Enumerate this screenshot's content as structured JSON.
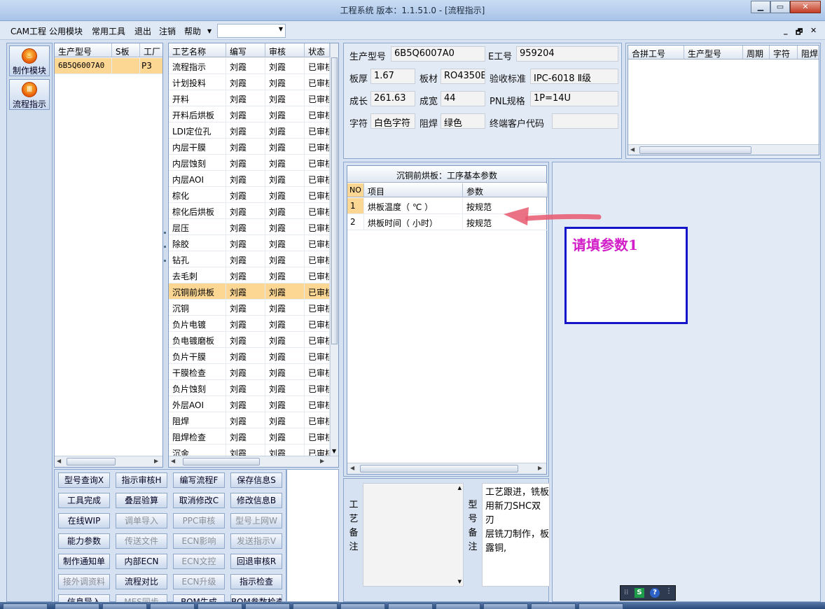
{
  "window": {
    "title": "工程系统   版本：1.1.51.0 - [流程指示]"
  },
  "menu": [
    "CAM工程",
    "公用模块",
    "常用工具",
    "退出",
    "注销",
    "帮助"
  ],
  "nav": [
    {
      "label": "制作模块",
      "icon": "flame-icon"
    },
    {
      "label": "流程指示",
      "icon": "flow-icon"
    }
  ],
  "model_grid": {
    "headers": [
      "生产型号",
      "S板",
      "工厂"
    ],
    "rows": [
      [
        "6B5Q6007A0",
        "",
        "P3"
      ]
    ]
  },
  "process_grid": {
    "headers": [
      "工艺名称",
      "编写",
      "审核",
      "状态"
    ],
    "selected_index": 14,
    "rows": [
      [
        "流程指示",
        "刘霞",
        "刘霞",
        "已审核"
      ],
      [
        "计划投料",
        "刘霞",
        "刘霞",
        "已审核"
      ],
      [
        "开料",
        "刘霞",
        "刘霞",
        "已审核"
      ],
      [
        "开料后烘板",
        "刘霞",
        "刘霞",
        "已审核"
      ],
      [
        "LDI定位孔",
        "刘霞",
        "刘霞",
        "已审核"
      ],
      [
        "内层干膜",
        "刘霞",
        "刘霞",
        "已审核"
      ],
      [
        "内层蚀刻",
        "刘霞",
        "刘霞",
        "已审核"
      ],
      [
        "内层AOI",
        "刘霞",
        "刘霞",
        "已审核"
      ],
      [
        "棕化",
        "刘霞",
        "刘霞",
        "已审核"
      ],
      [
        "棕化后烘板",
        "刘霞",
        "刘霞",
        "已审核"
      ],
      [
        "层压",
        "刘霞",
        "刘霞",
        "已审核"
      ],
      [
        "除胶",
        "刘霞",
        "刘霞",
        "已审核"
      ],
      [
        "钻孔",
        "刘霞",
        "刘霞",
        "已审核"
      ],
      [
        "去毛刺",
        "刘霞",
        "刘霞",
        "已审核"
      ],
      [
        "沉铜前烘板",
        "刘霞",
        "刘霞",
        "已审核"
      ],
      [
        "沉铜",
        "刘霞",
        "刘霞",
        "已审核"
      ],
      [
        "负片电镀",
        "刘霞",
        "刘霞",
        "已审核"
      ],
      [
        "负电镀磨板",
        "刘霞",
        "刘霞",
        "已审核"
      ],
      [
        "负片干膜",
        "刘霞",
        "刘霞",
        "已审核"
      ],
      [
        "干膜检查",
        "刘霞",
        "刘霞",
        "已审核"
      ],
      [
        "负片蚀刻",
        "刘霞",
        "刘霞",
        "已审核"
      ],
      [
        "外层AOI",
        "刘霞",
        "刘霞",
        "已审核"
      ],
      [
        "阻焊",
        "刘霞",
        "刘霞",
        "已审核"
      ],
      [
        "阻焊检查",
        "刘霞",
        "刘霞",
        "已审核"
      ],
      [
        "沉金",
        "刘霞",
        "刘霞",
        "已审核"
      ]
    ]
  },
  "buttons": [
    {
      "label": "型号查询X",
      "enabled": true
    },
    {
      "label": "指示审核H",
      "enabled": true
    },
    {
      "label": "编写流程F",
      "enabled": true
    },
    {
      "label": "保存信息S",
      "enabled": true
    },
    {
      "label": "工具完成",
      "enabled": true
    },
    {
      "label": "叠层验算",
      "enabled": true
    },
    {
      "label": "取消修改C",
      "enabled": true
    },
    {
      "label": "修改信息B",
      "enabled": true
    },
    {
      "label": "在线WIP",
      "enabled": true
    },
    {
      "label": "调单导入",
      "enabled": false
    },
    {
      "label": "PPC审核",
      "enabled": false
    },
    {
      "label": "型号上网W",
      "enabled": false
    },
    {
      "label": "能力参数",
      "enabled": true
    },
    {
      "label": "传送文件",
      "enabled": false
    },
    {
      "label": "ECN影响",
      "enabled": false
    },
    {
      "label": "发送指示V",
      "enabled": false
    },
    {
      "label": "制作通知单",
      "enabled": true
    },
    {
      "label": "内部ECN",
      "enabled": true
    },
    {
      "label": "ECN文控",
      "enabled": false
    },
    {
      "label": "回退审核R",
      "enabled": true
    },
    {
      "label": "接外调资料",
      "enabled": false
    },
    {
      "label": "流程对比",
      "enabled": true
    },
    {
      "label": "ECN升级",
      "enabled": false
    },
    {
      "label": "指示检查",
      "enabled": true
    },
    {
      "label": "信息导入",
      "enabled": true
    },
    {
      "label": "MES同步",
      "enabled": false
    },
    {
      "label": "BOM生成",
      "enabled": true
    },
    {
      "label": "BOM参数检查",
      "enabled": true
    }
  ],
  "info": {
    "model_label": "生产型号",
    "model_value": "6B5Q6007A0",
    "eno_label": "E工号",
    "eno_value": "959204",
    "thick_label": "板厚",
    "thick_value": "1.67",
    "mat_label": "板材",
    "mat_value": "RO4350B",
    "std_label": "验收标准",
    "std_value": "IPC-6018 Ⅱ级",
    "len_label": "成长",
    "len_value": "261.63",
    "wid_label": "成宽",
    "wid_value": "44",
    "pnl_label": "PNL规格",
    "pnl_value": "1P=14U",
    "char_label": "字符",
    "char_value": "白色字符",
    "mask_label": "阻焊",
    "mask_value": "绿色",
    "cust_label": "终端客户代码",
    "cust_value": ""
  },
  "merge_grid": {
    "headers": [
      "合拼工号",
      "生产型号",
      "周期",
      "字符",
      "阻焊"
    ]
  },
  "params": {
    "title": "沉铜前烘板：工序基本参数",
    "headers": [
      "NO",
      "项目",
      "参数"
    ],
    "rows": [
      [
        "1",
        "烘板温度（ ℃ ）",
        "按规范"
      ],
      [
        "2",
        "烘板时间（ 小时）",
        "按规范"
      ]
    ]
  },
  "annotation": "请填参数1",
  "remarks": {
    "process_label": [
      "工",
      "艺",
      "备",
      "注"
    ],
    "model_label": [
      "型",
      "号",
      "备",
      "注"
    ],
    "model_text": [
      "工艺跟进，铣板",
      "用新刀SHC双刃",
      "层铣刀制作，板",
      "露铜,"
    ]
  },
  "colors": {
    "selected_row": "#fcd793",
    "annotation_border": "#1414c8",
    "annotation_text": "#d21ec8",
    "arrow": "#e8586e"
  }
}
